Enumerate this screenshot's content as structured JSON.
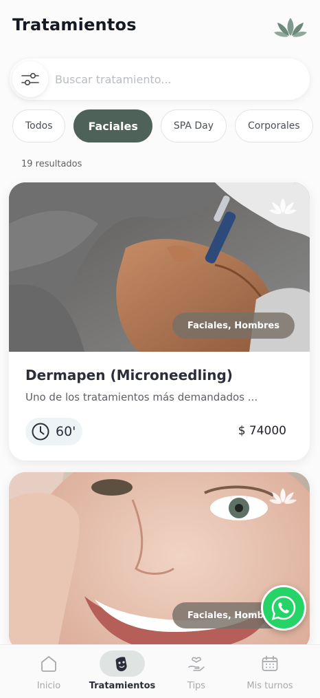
{
  "header": {
    "title": "Tratamientos",
    "logo_icon": "lotus-leaves-icon"
  },
  "search": {
    "placeholder": "Buscar tratamiento...",
    "value": "",
    "filter_icon": "sliders-icon"
  },
  "categories": [
    {
      "label": "Todos",
      "active": false
    },
    {
      "label": "Faciales",
      "active": true
    },
    {
      "label": "SPA Day",
      "active": false
    },
    {
      "label": "Corporales",
      "active": false
    }
  ],
  "results": {
    "count_label": "19 resultados"
  },
  "treatments": [
    {
      "title": "Dermapen (Microneedling)",
      "description": "Uno de los tratamientos más demandados ...",
      "tags": "Faciales, Hombres",
      "duration": "60'",
      "price": "$ 74000"
    },
    {
      "title": "",
      "description": "",
      "tags": "Faciales, Hombres",
      "duration": "",
      "price": ""
    }
  ],
  "bottom_nav": [
    {
      "label": "Inicio",
      "icon": "home-icon",
      "active": false
    },
    {
      "label": "Tratamientos",
      "icon": "face-mask-icon",
      "active": true
    },
    {
      "label": "Tips",
      "icon": "heart-hand-icon",
      "active": false
    },
    {
      "label": "Mis turnos",
      "icon": "calendar-icon",
      "active": false
    }
  ],
  "colors": {
    "accent": "#4f6259",
    "tag_background": "#787068",
    "whatsapp": "#25d366",
    "text_dark": "#141a24"
  }
}
